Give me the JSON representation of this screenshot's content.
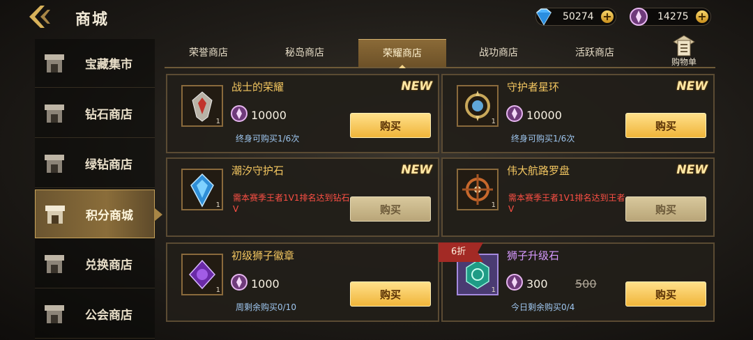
{
  "header": {
    "title": "商城"
  },
  "currencies": [
    {
      "icon": "diamond-icon",
      "value": "50274"
    },
    {
      "icon": "honor-points-icon",
      "value": "14275"
    }
  ],
  "sidebar": {
    "items": [
      {
        "label": "宝藏集市"
      },
      {
        "label": "钻石商店"
      },
      {
        "label": "绿钻商店"
      },
      {
        "label": "积分商城"
      },
      {
        "label": "兑换商店"
      },
      {
        "label": "公会商店"
      }
    ],
    "active_index": 3
  },
  "tabs": {
    "items": [
      {
        "label": "荣誉商店"
      },
      {
        "label": "秘岛商店"
      },
      {
        "label": "荣耀商店"
      },
      {
        "label": "战功商店"
      },
      {
        "label": "活跃商店"
      }
    ],
    "active_index": 2,
    "cart_label": "购物单"
  },
  "products": [
    {
      "name": "战士的荣耀",
      "tag": "NEW",
      "qty": "1",
      "price": "10000",
      "limit": "终身可购买1/6次",
      "buy": "购买"
    },
    {
      "name": "守护者星环",
      "tag": "NEW",
      "qty": "1",
      "price": "10000",
      "limit": "终身可购买1/6次",
      "buy": "购买"
    },
    {
      "name": "潮汐守护石",
      "tag": "NEW",
      "qty": "1",
      "requirement": "需本赛季王者1V1排名达到钻石V",
      "buy": "购买"
    },
    {
      "name": "伟大航路罗盘",
      "tag": "NEW",
      "qty": "1",
      "requirement": "需本赛季王者1V1排名达到王者V",
      "buy": "购买"
    },
    {
      "name": "初级狮子徽章",
      "qty": "1",
      "price": "1000",
      "limit": "周剩余购买0/10",
      "buy": "购买"
    },
    {
      "name": "狮子升级石",
      "discount": "6折",
      "qty": "1",
      "price": "300",
      "original_price": "500",
      "limit": "今日剩余购买0/4",
      "buy": "购买"
    }
  ],
  "colors": {
    "accent_gold": "#f3c660",
    "requirement_red": "#ff5045",
    "limit_blue": "#9ec6ef"
  }
}
